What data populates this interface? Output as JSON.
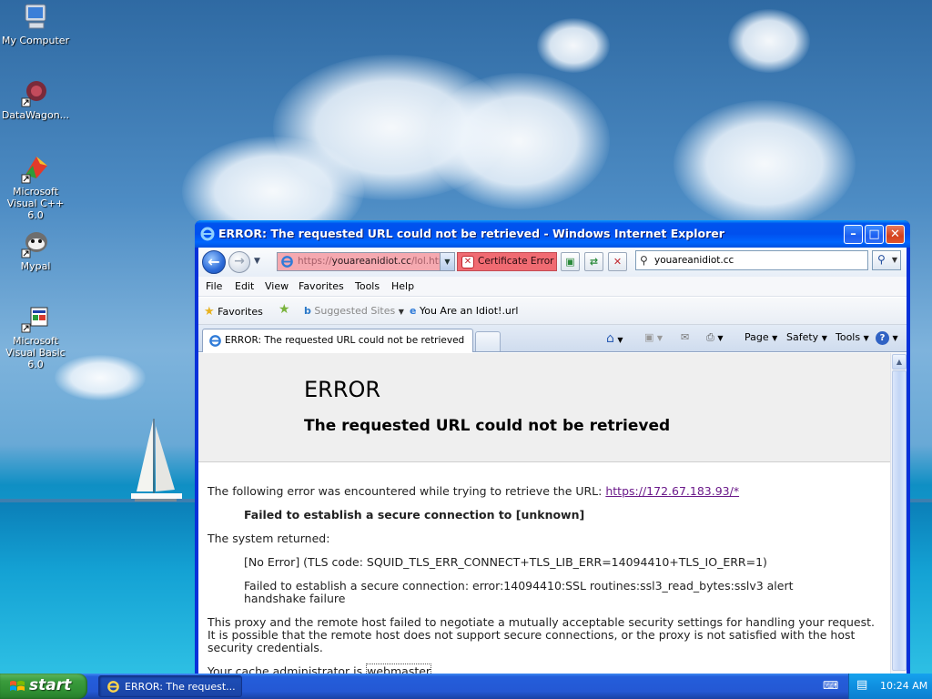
{
  "desktop": {
    "icons": [
      {
        "label": "My Computer"
      },
      {
        "label": "DataWagon..."
      },
      {
        "label": "Microsoft Visual C++ 6.0"
      },
      {
        "label": "Mypal"
      },
      {
        "label": "Microsoft Visual Basic 6.0"
      }
    ]
  },
  "window": {
    "title": "ERROR: The requested URL could not be retrieved - Windows Internet Explorer",
    "address": {
      "url_prefix": "https://",
      "url_host": "youareanidiot.cc",
      "url_suffix": "/lol.html",
      "cert_error": "Certificate Error"
    },
    "search": {
      "value": "youareanidiot.cc"
    },
    "menu": [
      "File",
      "Edit",
      "View",
      "Favorites",
      "Tools",
      "Help"
    ],
    "favorites_bar": {
      "favorites_label": "Favorites",
      "suggested_sites": "Suggested Sites",
      "link": "You Are an Idiot!.url"
    },
    "tab": {
      "title": "ERROR: The requested URL could not be retrieved"
    },
    "command_bar": {
      "page": "Page",
      "safety": "Safety",
      "tools": "Tools"
    },
    "page": {
      "heading": "ERROR",
      "subheading": "The requested URL could not be retrieved",
      "intro": "The following error was encountered while trying to retrieve the URL:",
      "intro_link": "https://172.67.183.93/*",
      "error_bold": "Failed to establish a secure connection to [unknown]",
      "system_returned": "The system returned:",
      "tls_line": "[No Error] (TLS code: SQUID_TLS_ERR_CONNECT+TLS_LIB_ERR=14094410+TLS_IO_ERR=1)",
      "ssl_line1": "Failed to establish a secure connection: error:14094410:SSL routines:ssl3_read_bytes:sslv3 alert",
      "ssl_line2": "handshake failure",
      "proxy_line1": "This proxy and the remote host failed to negotiate a mutually acceptable security settings for handling your request.",
      "proxy_line2": "It is possible that the remote host does not support secure connections, or the proxy is not satisfied with the host",
      "proxy_line3": "security credentials.",
      "cache_admin": "Your cache administrator is",
      "webmaster": "webmaster"
    }
  },
  "taskbar": {
    "start_label": "start",
    "task_label": "ERROR: The request...",
    "clock": "10:24 AM"
  }
}
